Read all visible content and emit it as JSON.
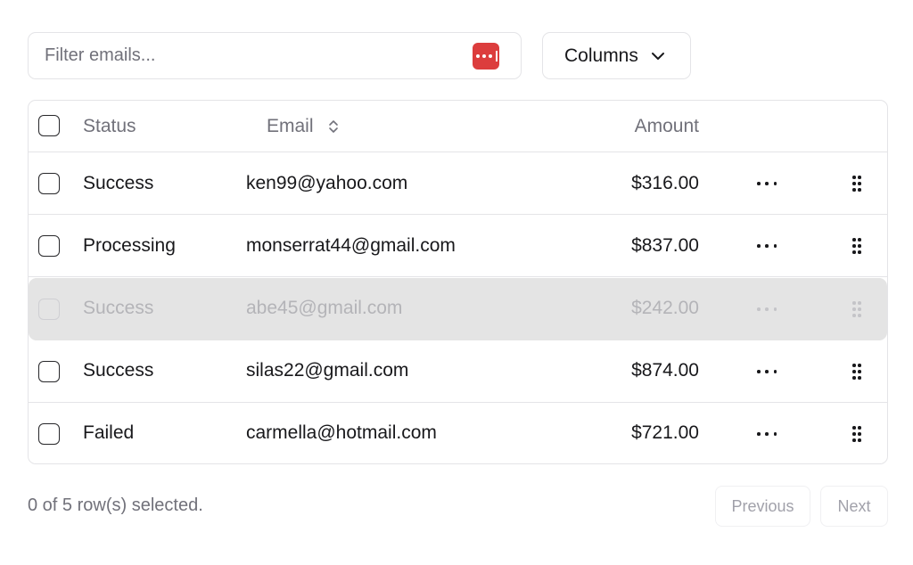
{
  "filter": {
    "placeholder": "Filter emails...",
    "icon": "password-manager-icon",
    "icon_color": "#dc3d3d"
  },
  "columns_button": {
    "label": "Columns"
  },
  "table": {
    "headers": {
      "status": "Status",
      "email": "Email",
      "amount": "Amount"
    },
    "rows": [
      {
        "status": "Success",
        "email": "ken99@yahoo.com",
        "amount": "$316.00"
      },
      {
        "status": "Processing",
        "email": "monserrat44@gmail.com",
        "amount": "$837.00"
      },
      {
        "status": "Success",
        "email": "abe45@gmail.com",
        "amount": "$242.00"
      },
      {
        "status": "Success",
        "email": "silas22@gmail.com",
        "amount": "$874.00"
      },
      {
        "status": "Failed",
        "email": "carmella@hotmail.com",
        "amount": "$721.00"
      }
    ]
  },
  "footer": {
    "selection_text": "0 of 5 row(s) selected.",
    "previous_label": "Previous",
    "next_label": "Next"
  }
}
